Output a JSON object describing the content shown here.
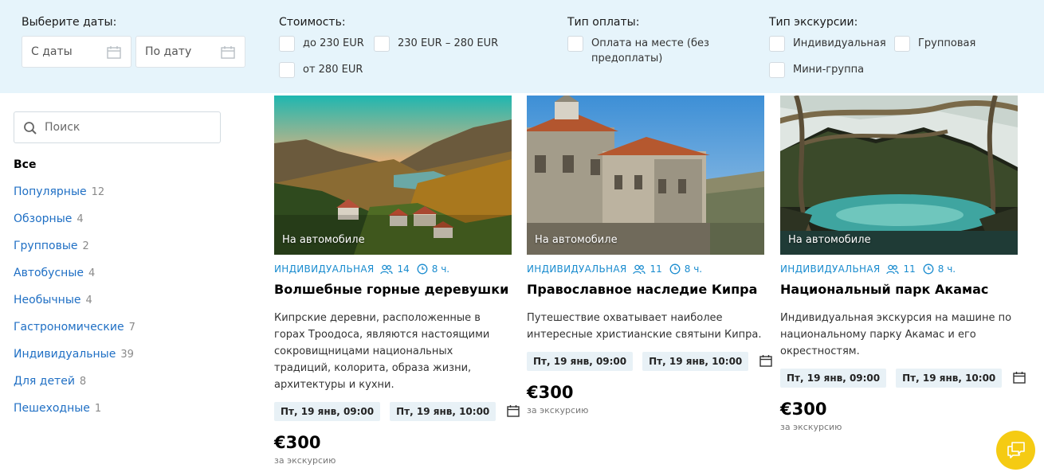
{
  "filters": {
    "dates": {
      "title": "Выберите даты:",
      "from_placeholder": "С даты",
      "to_placeholder": "По дату"
    },
    "price": {
      "title": "Стоимость:",
      "options": [
        "до 230 EUR",
        "230 EUR – 280 EUR",
        "от 280 EUR"
      ]
    },
    "payment": {
      "title": "Тип оплаты:",
      "options": [
        "Оплата на месте (без предоплаты)"
      ]
    },
    "excursion_type": {
      "title": "Тип экскурсии:",
      "options": [
        "Индивидуальная",
        "Групповая",
        "Мини-группа"
      ]
    }
  },
  "sidebar": {
    "search_placeholder": "Поиск",
    "all_label": "Все",
    "categories": [
      {
        "name": "Популярные",
        "count": "12"
      },
      {
        "name": "Обзорные",
        "count": "4"
      },
      {
        "name": "Групповые",
        "count": "2"
      },
      {
        "name": "Автобусные",
        "count": "4"
      },
      {
        "name": "Необычные",
        "count": "4"
      },
      {
        "name": "Гастрономические",
        "count": "7"
      },
      {
        "name": "Индивидуальные",
        "count": "39"
      },
      {
        "name": "Для детей",
        "count": "8"
      },
      {
        "name": "Пешеходные",
        "count": "1"
      }
    ]
  },
  "cards": [
    {
      "transport": "На автомобиле",
      "type": "ИНДИВИДУАЛЬНАЯ",
      "group_size": "14",
      "duration": "8 ч.",
      "title": "Волшебные горные деревушки",
      "description": "Кипрские деревни, расположенные в горах Троодоса, являются настоящими сокровищницами национальных традиций, колорита, образа жизни, архитектуры и кухни.",
      "dates": [
        "Пт, 19 янв, 09:00",
        "Пт, 19 янв, 10:00"
      ],
      "price": "€300",
      "price_note": "за экскурсию"
    },
    {
      "transport": "На автомобиле",
      "type": "ИНДИВИДУАЛЬНАЯ",
      "group_size": "11",
      "duration": "8 ч.",
      "title": "Православное наследие Кипра",
      "description": "Путешествие охватывает наиболее интересные христианские святыни Кипра.",
      "dates": [
        "Пт, 19 янв, 09:00",
        "Пт, 19 янв, 10:00"
      ],
      "price": "€300",
      "price_note": "за экскурсию"
    },
    {
      "transport": "На автомобиле",
      "type": "ИНДИВИДУАЛЬНАЯ",
      "group_size": "11",
      "duration": "8 ч.",
      "title": "Национальный парк Акамас",
      "description": "Индивидуальная экскурсия на машине по национальному парку Акамас и его окрестностям.",
      "dates": [
        "Пт, 19 янв, 09:00",
        "Пт, 19 янв, 10:00"
      ],
      "price": "€300",
      "price_note": "за экскурсию"
    }
  ],
  "colors": {
    "filter_bg": "#e6f4fb",
    "link": "#1f6fc4",
    "accent": "#1a8ccf",
    "chat_button": "#f5cb13"
  },
  "icons": {
    "calendar": "calendar-icon",
    "search": "search-icon",
    "group": "group-icon",
    "clock": "clock-icon",
    "chat": "chat-icon"
  }
}
